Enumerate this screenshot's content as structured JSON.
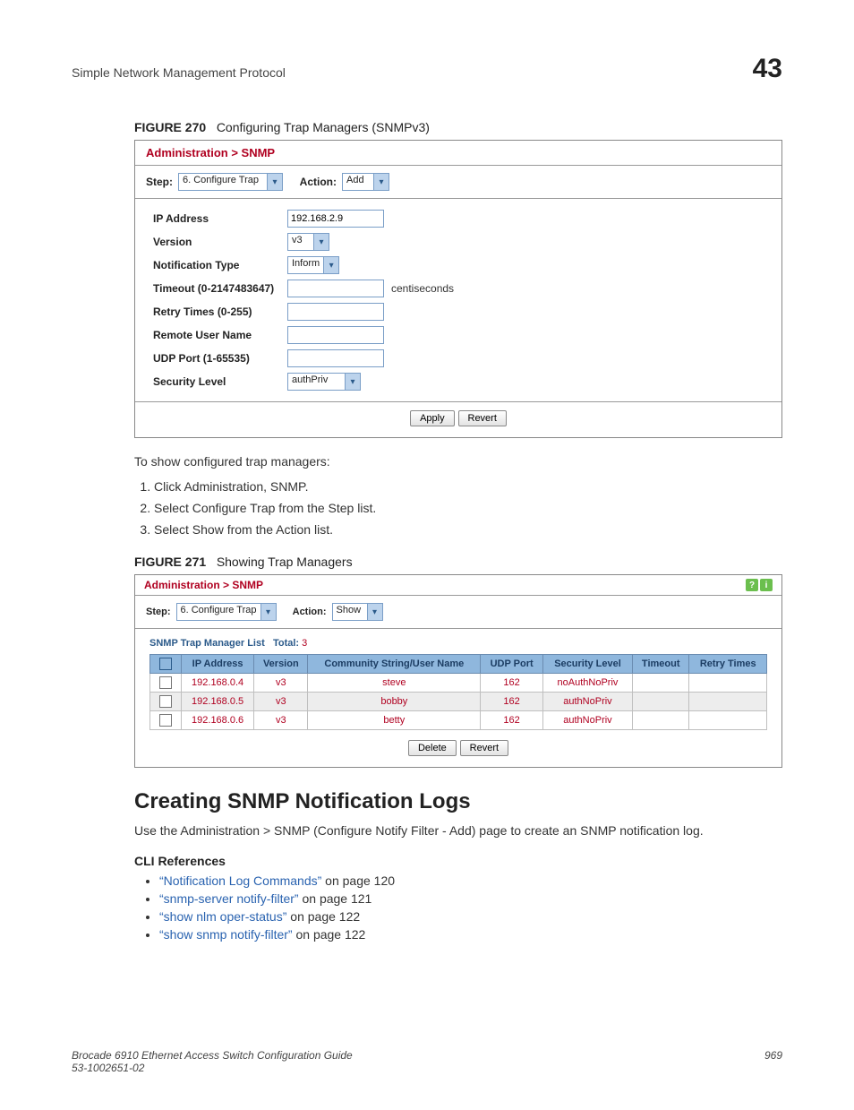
{
  "top_header": {
    "left": "Simple Network Management Protocol",
    "right": "43"
  },
  "fig270": {
    "label": "FIGURE 270",
    "title": "Configuring Trap Managers (SNMPv3)",
    "panel_title": "Administration > SNMP",
    "step_label": "Step:",
    "step_value": "6. Configure Trap",
    "action_label": "Action:",
    "action_value": "Add",
    "fields": {
      "ip_label": "IP Address",
      "ip_value": "192.168.2.9",
      "version_label": "Version",
      "version_value": "v3",
      "notif_label": "Notification Type",
      "notif_value": "Inform",
      "timeout_label": "Timeout (0-2147483647)",
      "timeout_value": "",
      "timeout_unit": "centiseconds",
      "retry_label": "Retry Times (0-255)",
      "retry_value": "",
      "user_label": "Remote User Name",
      "user_value": "",
      "udp_label": "UDP Port (1-65535)",
      "udp_value": "",
      "sec_label": "Security Level",
      "sec_value": "authPriv"
    },
    "apply": "Apply",
    "revert": "Revert"
  },
  "intro_text": "To show configured trap managers:",
  "steps": [
    "Click Administration, SNMP.",
    "Select Configure Trap from the Step list.",
    "Select Show from the Action list."
  ],
  "fig271": {
    "label": "FIGURE 271",
    "title": "Showing Trap Managers",
    "panel_title": "Administration > SNMP",
    "step_label": "Step:",
    "step_value": "6. Configure Trap",
    "action_label": "Action:",
    "action_value": "Show",
    "list_title": "SNMP Trap Manager List",
    "total_label": "Total:",
    "total_value": "3",
    "columns": [
      "",
      "IP Address",
      "Version",
      "Community String/User Name",
      "UDP Port",
      "Security Level",
      "Timeout",
      "Retry Times"
    ],
    "rows": [
      {
        "ip": "192.168.0.4",
        "ver": "v3",
        "user": "steve",
        "port": "162",
        "sec": "noAuthNoPriv",
        "timeout": "",
        "retry": ""
      },
      {
        "ip": "192.168.0.5",
        "ver": "v3",
        "user": "bobby",
        "port": "162",
        "sec": "authNoPriv",
        "timeout": "",
        "retry": ""
      },
      {
        "ip": "192.168.0.6",
        "ver": "v3",
        "user": "betty",
        "port": "162",
        "sec": "authNoPriv",
        "timeout": "",
        "retry": ""
      }
    ],
    "delete": "Delete",
    "revert": "Revert"
  },
  "section_title": "Creating SNMP Notification Logs",
  "section_intro": "Use the Administration > SNMP (Configure Notify Filter - Add) page to create an SNMP notification log.",
  "cli_heading": "CLI References",
  "cli": [
    {
      "link": "“Notification Log Commands”",
      "tail": " on page 120"
    },
    {
      "link": "“snmp-server notify-filter”",
      "tail": " on page 121"
    },
    {
      "link": "“show nlm oper-status”",
      "tail": " on page 122"
    },
    {
      "link": "“show snmp notify-filter”",
      "tail": " on page 122"
    }
  ],
  "footer": {
    "left_line1": "Brocade 6910 Ethernet Access Switch Configuration Guide",
    "left_line2": "53-1002651-02",
    "right": "969"
  }
}
